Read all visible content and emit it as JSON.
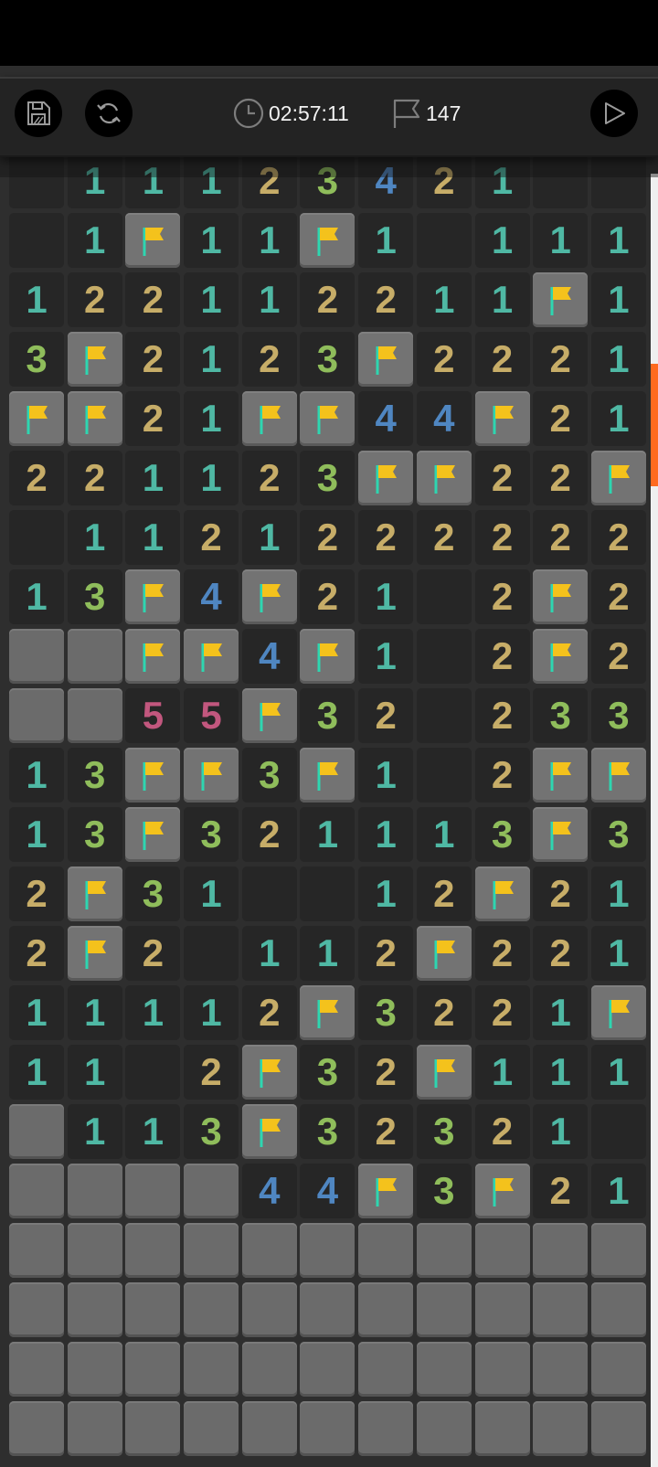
{
  "toolbar": {
    "timer": "02:57:11",
    "flags_count": "147",
    "icons": {
      "save": "floppy-save-icon",
      "restart": "refresh-icon",
      "timer": "clock-icon",
      "flags": "flag-icon",
      "play": "play-icon"
    }
  },
  "legend": {
    "cell_codes": "h = hidden, . = open blank, F = flagged, 1-5 = adjacent mine count"
  },
  "colors": {
    "n1": "#4fb8a4",
    "n2": "#c7ad68",
    "n3": "#8fbd5b",
    "n4": "#4f86c1",
    "n5": "#c2577e",
    "flag": "#f4c21c",
    "flag_pole": "#2ed6b0",
    "accent_scroll": "#ff6a1f"
  },
  "board": {
    "columns": 11,
    "rows": [
      [
        ".",
        "1",
        "1",
        "1",
        "2",
        "3",
        "4",
        "2",
        "1",
        ".",
        "."
      ],
      [
        ".",
        "1",
        "F",
        "1",
        "1",
        "F",
        "1",
        ".",
        "1",
        "1",
        "1"
      ],
      [
        "1",
        "2",
        "2",
        "1",
        "1",
        "2",
        "2",
        "1",
        "1",
        "F",
        "1"
      ],
      [
        "3",
        "F",
        "2",
        "1",
        "2",
        "3",
        "F",
        "2",
        "2",
        "2",
        "1"
      ],
      [
        "F",
        "F",
        "2",
        "1",
        "F",
        "F",
        "4",
        "4",
        "F",
        "2",
        "1"
      ],
      [
        "2",
        "2",
        "1",
        "1",
        "2",
        "3",
        "F",
        "F",
        "2",
        "2",
        "F"
      ],
      [
        ".",
        "1",
        "1",
        "2",
        "1",
        "2",
        "2",
        "2",
        "2",
        "2",
        "2"
      ],
      [
        "1",
        "3",
        "F",
        "4",
        "F",
        "2",
        "1",
        ".",
        "2",
        "F",
        "2"
      ],
      [
        "h",
        "h",
        "F",
        "F",
        "4",
        "F",
        "1",
        ".",
        "2",
        "F",
        "2"
      ],
      [
        "h",
        "h",
        "5",
        "5",
        "F",
        "3",
        "2",
        ".",
        "2",
        "3",
        "3"
      ],
      [
        "1",
        "3",
        "F",
        "F",
        "3",
        "F",
        "1",
        ".",
        "2",
        "F",
        "F"
      ],
      [
        "1",
        "3",
        "F",
        "3",
        "2",
        "1",
        "1",
        "1",
        "3",
        "F",
        "3"
      ],
      [
        "2",
        "F",
        "3",
        "1",
        ".",
        ".",
        "1",
        "2",
        "F",
        "2",
        "1"
      ],
      [
        "2",
        "F",
        "2",
        ".",
        "1",
        "1",
        "2",
        "F",
        "2",
        "2",
        "1"
      ],
      [
        "1",
        "1",
        "1",
        "1",
        "2",
        "F",
        "3",
        "2",
        "2",
        "1",
        "F"
      ],
      [
        "1",
        "1",
        ".",
        "2",
        "F",
        "3",
        "2",
        "F",
        "1",
        "1",
        "1"
      ],
      [
        "h",
        "1",
        "1",
        "3",
        "F",
        "3",
        "2",
        "3",
        "2",
        "1",
        "."
      ],
      [
        "h",
        "h",
        "h",
        "h",
        "4",
        "4",
        "F",
        "3",
        "F",
        "2",
        "1"
      ],
      [
        "h",
        "h",
        "h",
        "h",
        "h",
        "h",
        "h",
        "h",
        "h",
        "h",
        "h"
      ],
      [
        "h",
        "h",
        "h",
        "h",
        "h",
        "h",
        "h",
        "h",
        "h",
        "h",
        "h"
      ],
      [
        "h",
        "h",
        "h",
        "h",
        "h",
        "h",
        "h",
        "h",
        "h",
        "h",
        "h"
      ],
      [
        "h",
        "h",
        "h",
        "h",
        "h",
        "h",
        "h",
        "h",
        "h",
        "h",
        "h"
      ]
    ]
  }
}
